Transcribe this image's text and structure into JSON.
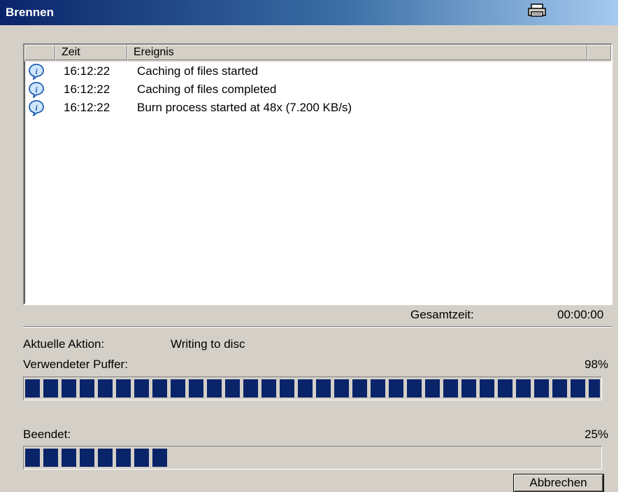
{
  "window": {
    "title": "Brennen"
  },
  "toolbar": {
    "print_icon": "printer-icon"
  },
  "log": {
    "columns": [
      "",
      "Zeit",
      "Ereignis",
      ""
    ],
    "rows": [
      {
        "icon": "info-icon",
        "time": "16:12:22",
        "event": "Caching of files started"
      },
      {
        "icon": "info-icon",
        "time": "16:12:22",
        "event": "Caching of files completed"
      },
      {
        "icon": "info-icon",
        "time": "16:12:22",
        "event": "Burn process started at 48x (7.200 KB/s)"
      }
    ]
  },
  "totals": {
    "label": "Gesamtzeit:",
    "value": "00:00:00"
  },
  "action": {
    "label": "Aktuelle Aktion:",
    "value": "Writing to disc"
  },
  "buffer": {
    "label": "Verwendeter Puffer:",
    "value": "98%",
    "fraction": 0.98
  },
  "finished": {
    "label": "Beendet:",
    "value": "25%",
    "fraction": 0.25
  },
  "buttons": {
    "cancel": "Abbrechen"
  },
  "colors": {
    "titlebar_start": "#0a246a",
    "titlebar_end": "#a6caf0",
    "progress_fill": "#0a246a",
    "dialog_bg": "#d4d0c8"
  }
}
